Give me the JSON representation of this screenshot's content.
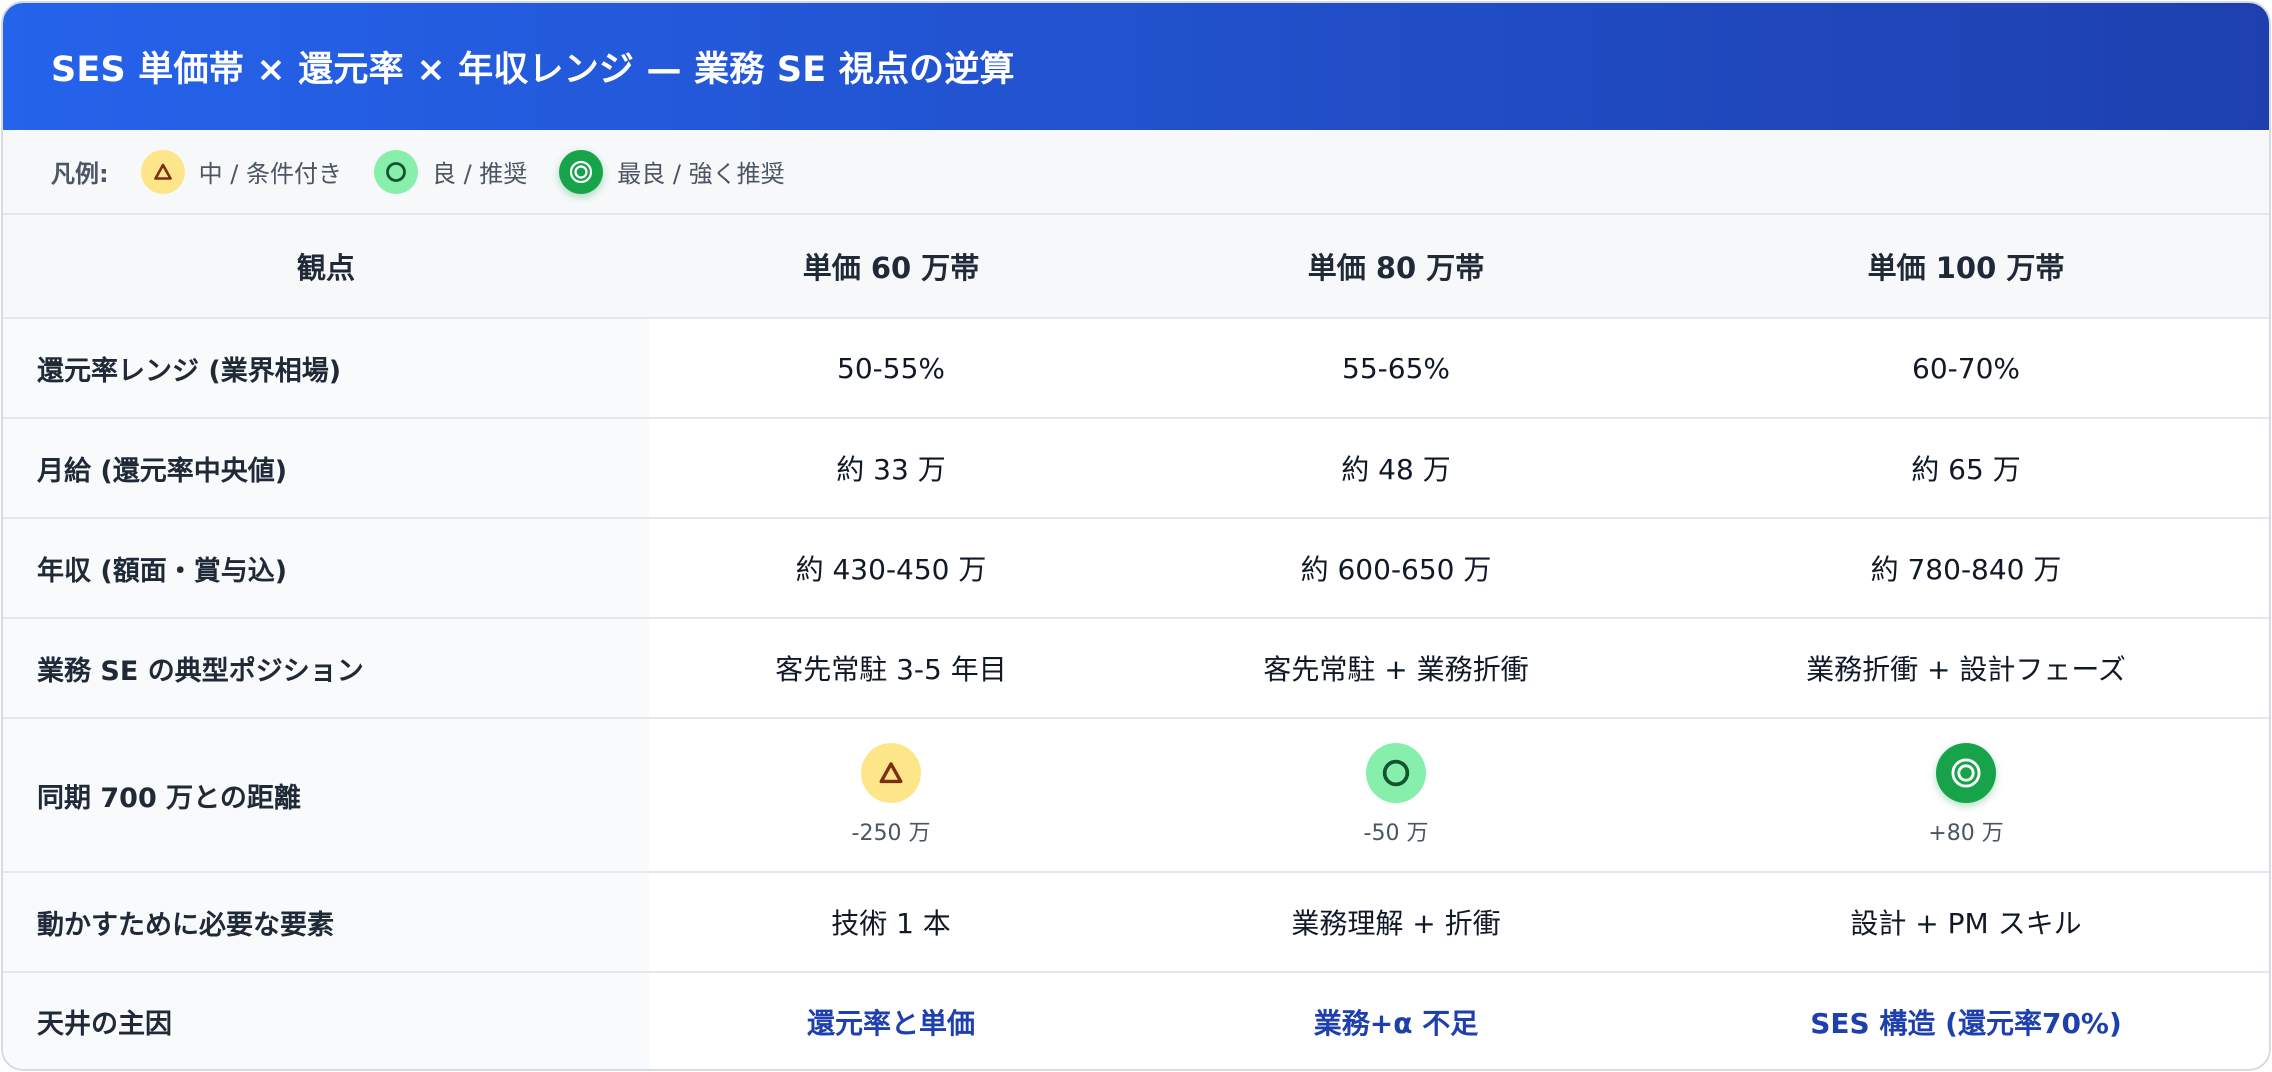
{
  "header": {
    "title": "SES 単価帯 × 還元率 × 年収レンジ — 業務 SE 視点の逆算"
  },
  "legend": {
    "label": "凡例:",
    "items": [
      {
        "icon": "triangle-icon",
        "text": "中 / 条件付き",
        "color": "#fde68a"
      },
      {
        "icon": "circle-icon",
        "text": "良 / 推奨",
        "color": "#86efac"
      },
      {
        "icon": "double-circle-icon",
        "text": "最良 / 強く推奨",
        "color": "#16a34a"
      }
    ]
  },
  "table": {
    "headers": [
      "観点",
      "単価 60 万帯",
      "単価 80 万帯",
      "単価 100 万帯"
    ],
    "rows": {
      "return_rate": {
        "label": "還元率レンジ (業界相場)",
        "values": [
          "50-55%",
          "55-65%",
          "60-70%"
        ]
      },
      "monthly": {
        "label": "月給 (還元率中央値)",
        "values": [
          "約 33 万",
          "約 48 万",
          "約 65 万"
        ]
      },
      "annual": {
        "label": "年収 (額面・賞与込)",
        "values": [
          "約 430-450 万",
          "約 600-650 万",
          "約 780-840 万"
        ]
      },
      "position": {
        "label": "業務 SE の典型ポジション",
        "values": [
          "客先常駐 3-5 年目",
          "客先常駐 + 業務折衝",
          "業務折衝 + 設計フェーズ"
        ]
      },
      "distance": {
        "label": "同期 700 万との距離",
        "cells": [
          {
            "rating": "triangle-icon",
            "delta": "-250 万"
          },
          {
            "rating": "circle-icon",
            "delta": "-50 万"
          },
          {
            "rating": "double-circle-icon",
            "delta": "+80 万"
          }
        ]
      },
      "requirements": {
        "label": "動かすために必要な要素",
        "values": [
          "技術 1 本",
          "業務理解 + 折衝",
          "設計 + PM スキル"
        ]
      },
      "ceiling": {
        "label": "天井の主因",
        "values": [
          "還元率と単価",
          "業務+α 不足",
          "SES 構造 (還元率70%)"
        ]
      }
    }
  },
  "colors": {
    "header_start": "#2563eb",
    "header_end": "#1e40af",
    "accent_text": "#1e40af",
    "mid": "#fde68a",
    "good": "#86efac",
    "best": "#16a34a"
  }
}
